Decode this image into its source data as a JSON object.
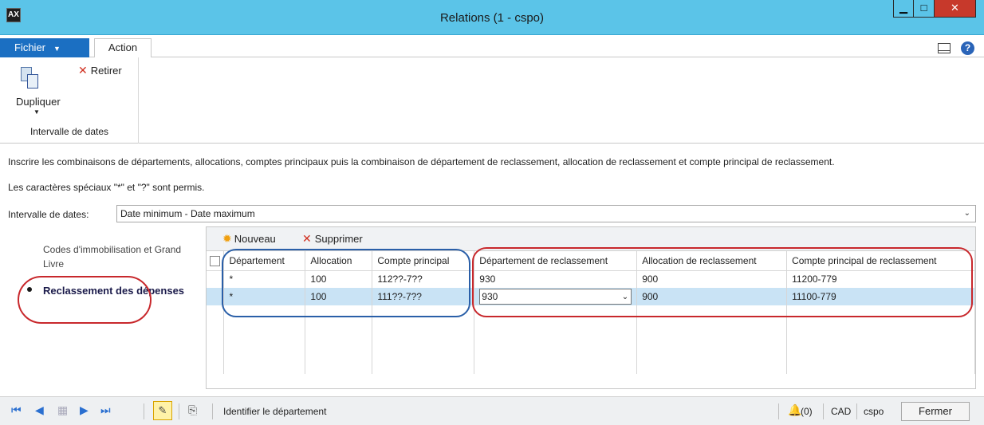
{
  "window": {
    "title": "Relations (1 - cspo)",
    "app_icon": "dynamics-ax-icon"
  },
  "ribbon_tabs": {
    "file": "Fichier",
    "action": "Action"
  },
  "ribbon": {
    "duplicate_label": "Dupliquer",
    "remove_label": "Retirer",
    "group_label": "Intervalle de dates"
  },
  "instructions": {
    "line1": "Inscrire les combinaisons de départements, allocations, comptes principaux puis la combinaison de département de reclassement, allocation de reclassement et compte principal de reclassement.",
    "line2": "Les caractères spéciaux \"*\" et \"?\" sont permis."
  },
  "date_range": {
    "label": "Intervalle de dates:",
    "value": "Date minimum - Date maximum"
  },
  "sidenav": {
    "items": [
      {
        "label": "Codes d'immobilisation et Grand Livre"
      },
      {
        "label": "Reclassement des dépenses"
      }
    ]
  },
  "grid_toolbar": {
    "new_label": "Nouveau",
    "delete_label": "Supprimer"
  },
  "grid": {
    "columns": [
      "Département",
      "Allocation",
      "Compte principal",
      "Département de reclassement",
      "Allocation de reclassement",
      "Compte principal de reclassement"
    ],
    "rows": [
      [
        "*",
        "100",
        "112??-7??",
        "930",
        "900",
        "11200-779"
      ],
      [
        "*",
        "100",
        "111??-7??",
        "930",
        "900",
        "11100-779"
      ]
    ]
  },
  "statusbar": {
    "text": "Identifier le département",
    "alerts": "(0)",
    "currency": "CAD",
    "company": "cspo",
    "close_label": "Fermer"
  },
  "colors": {
    "titlebar": "#5bc4e8",
    "file_tab": "#1b6fc2",
    "selected_row": "#c9e3f5",
    "annotation_red": "#c8282c",
    "annotation_blue": "#2a5fa8"
  }
}
